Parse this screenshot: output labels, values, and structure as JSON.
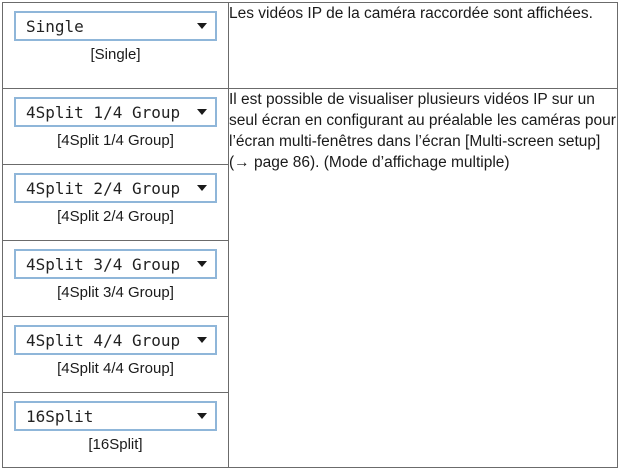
{
  "modes": [
    {
      "select_value": "Single",
      "caption": "[Single]"
    },
    {
      "select_value": "4Split 1/4 Group",
      "caption": "[4Split 1/4 Group]"
    },
    {
      "select_value": "4Split 2/4 Group",
      "caption": "[4Split 2/4 Group]"
    },
    {
      "select_value": "4Split 3/4 Group",
      "caption": "[4Split 3/4 Group]"
    },
    {
      "select_value": "4Split 4/4 Group",
      "caption": "[4Split 4/4 Group]"
    },
    {
      "select_value": "16Split",
      "caption": "[16Split]"
    }
  ],
  "descriptions": {
    "single": "Les vidéos IP de la caméra raccordée sont affichées.",
    "multi": "Il est possible de visualiser plusieurs vidéos IP sur un seul écran en configurant au préalable les caméras pour l’écran multi-fenêtres dans l’écran [Multi-screen setup] (→ page 86). (Mode d’affichage multiple)"
  }
}
